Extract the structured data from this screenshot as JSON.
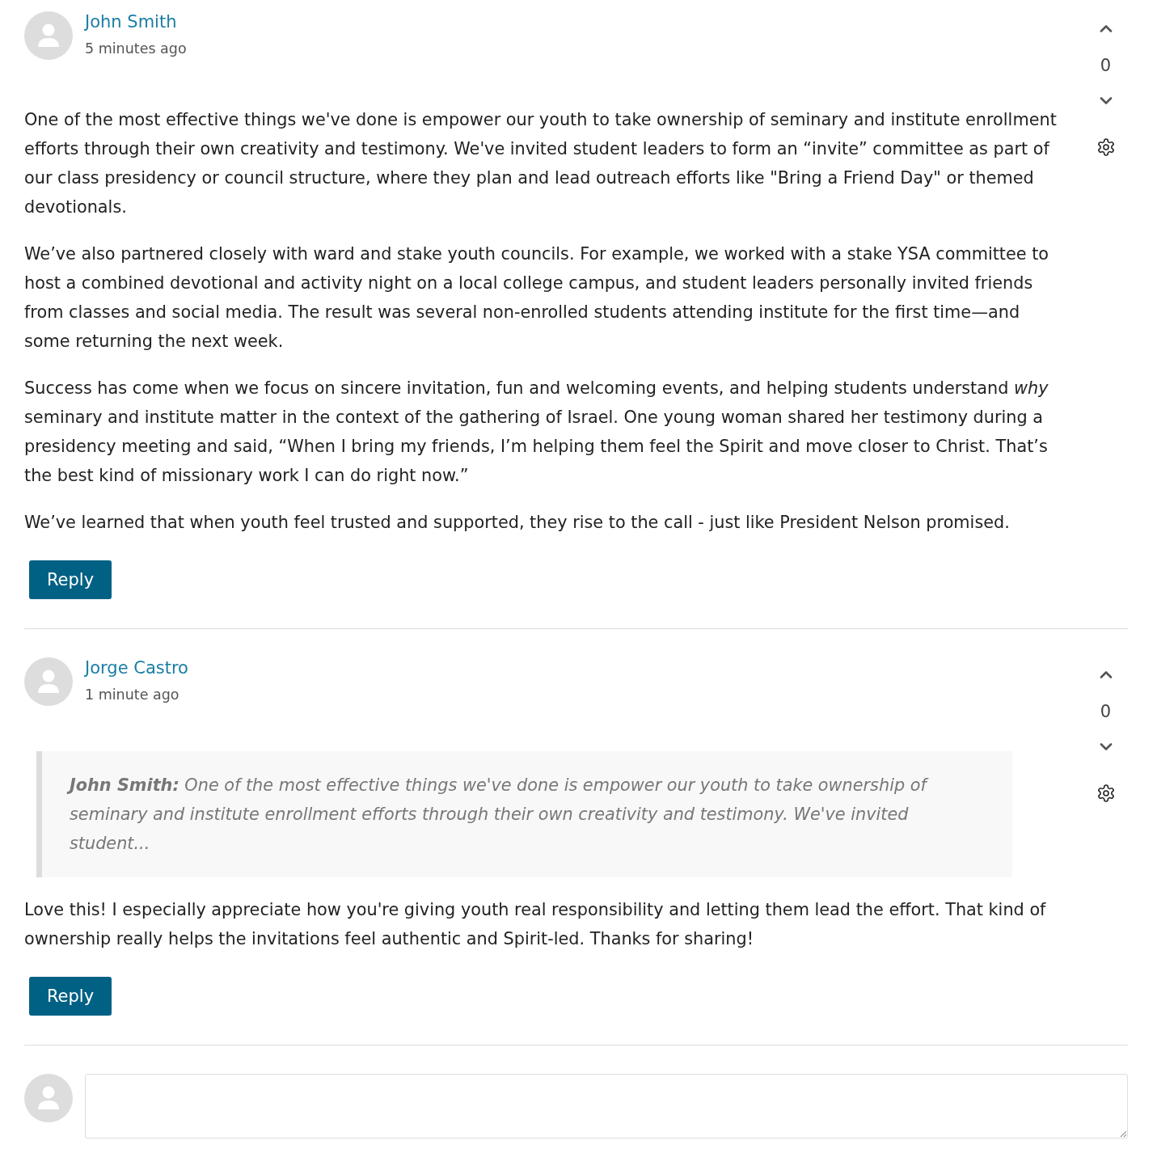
{
  "comments": [
    {
      "author": "John Smith",
      "time": "5 minutes ago",
      "votes": "0",
      "paragraphs": [
        "One of the most effective things we've done is empower our youth to take ownership of seminary and institute enrollment efforts through their own creativity and testimony. We've invited student leaders to form an “invite” committee as part of our class presidency or council structure, where they plan and lead outreach efforts like \"Bring a Friend Day\" or themed devotionals.",
        "We’ve also partnered closely with ward and stake youth councils. For example, we worked with a stake YSA committee to host a combined devotional and activity night on a local college campus, and student leaders personally invited friends from classes and social media. The result was several non-enrolled students attending institute for the first time—and some returning the next week.",
        "Success has come when we focus on sincere invitation, fun and welcoming events, and helping students understand *why* seminary and institute matter in the context of the gathering of Israel. One young woman shared her testimony during a presidency meeting and said, “When I bring my friends, I’m helping them feel the Spirit and move closer to Christ. That’s the best kind of missionary work I can do right now.”",
        "We’ve learned that when youth feel trusted and supported, they rise to the call - just like President Nelson promised."
      ],
      "reply_button": "Reply"
    },
    {
      "author": "Jorge Castro",
      "time": "1 minute ago",
      "votes": "0",
      "quote": "**John Smith:** One of the most effective things we've done is empower our youth to take ownership of seminary and institute enrollment efforts through their own creativity and testimony. We've invited student...",
      "paragraphs": [
        "Love this! I especially appreciate how you're giving youth real responsibility and letting them lead the effort. That kind of ownership really helps the invitations feel authentic and Spirit-led. Thanks for sharing!"
      ],
      "reply_button": "Reply"
    }
  ]
}
